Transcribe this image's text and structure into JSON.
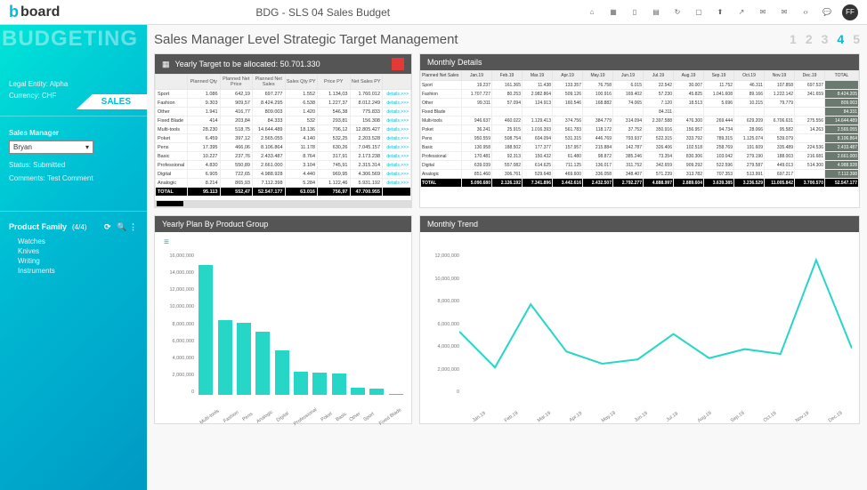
{
  "app": {
    "logo": "board",
    "title": "BDG - SLS 04 Sales Budget",
    "avatar": "FF"
  },
  "sidebar": {
    "watermark": "BUDGETING",
    "sales_tab": "SALES",
    "entity_label": "Legal Entity: Alpha",
    "currency_label": "Currency:  CHF",
    "manager_label": "Sales Manager",
    "manager_value": "Bryan",
    "status_label": "Status:  Submitted",
    "comments_label": "Comments: Test Comment",
    "pf_title": "Product Family",
    "pf_count": "(4/4)",
    "pf_items": [
      "Watches",
      "Knives",
      "Writing",
      "Instruments"
    ]
  },
  "page": {
    "title": "Sales Manager Level Strategic Target Management",
    "steps": [
      "1",
      "2",
      "3",
      "4",
      "5"
    ],
    "active_step": 4
  },
  "allocation": {
    "title": "Yearly Target to be allocated:  50.701.330",
    "headers": [
      "",
      "Planned Qty",
      "Planned Net Price",
      "Planned Net Sales",
      "Sales Qty PY",
      "Price PY",
      "Net Sales PY",
      ""
    ],
    "rows": [
      [
        "Sport",
        "1.086",
        "642,19",
        "697.277",
        "1.552",
        "1.134,03",
        "1.760.012",
        "details >>>"
      ],
      [
        "Fashion",
        "9.303",
        "909,57",
        "8.424.295",
        "6.538",
        "1.227,37",
        "8.012.249",
        "details >>>"
      ],
      [
        "Other",
        "1.941",
        "416,77",
        "809.003",
        "1.420",
        "546,38",
        "775.833",
        "details >>>"
      ],
      [
        "Fixed Blade",
        "414",
        "203,84",
        "84.333",
        "532",
        "293,81",
        "156.308",
        "details >>>"
      ],
      [
        "Multi-tools",
        "28.230",
        "518,75",
        "14.644.489",
        "18.136",
        "706,12",
        "12.805.427",
        "details >>>"
      ],
      [
        "Poket",
        "6.459",
        "397,12",
        "2.565.055",
        "4.140",
        "532,25",
        "2.203.528",
        "details >>>"
      ],
      [
        "Pens",
        "17.395",
        "466,06",
        "8.106.864",
        "11.178",
        "630,26",
        "7.045.157",
        "details >>>"
      ],
      [
        "Basic",
        "10.227",
        "237,76",
        "2.433.487",
        "8.764",
        "317,91",
        "2.173.238",
        "details >>>"
      ],
      [
        "Professional",
        "4.830",
        "550,89",
        "2.661.000",
        "3.104",
        "745,91",
        "2.315.314",
        "details >>>"
      ],
      [
        "Digital",
        "6.905",
        "722,65",
        "4.988.928",
        "4.440",
        "969,95",
        "4.306.569",
        "details >>>"
      ],
      [
        "Analogic",
        "8.214",
        "865,93",
        "7.112.398",
        "5.284",
        "1.122,46",
        "5.931.192",
        "details >>>"
      ]
    ],
    "total": [
      "TOTAL",
      "95.113",
      "552,47",
      "52.547.177",
      "63.016",
      "756,97",
      "47.700.955",
      ""
    ]
  },
  "monthly": {
    "title": "Monthly Details",
    "subheader": "Planned Net Sales",
    "months": [
      "Jan.19",
      "Feb.19",
      "Mar.19",
      "Apr.19",
      "May.19",
      "Jun.19",
      "Jul.19",
      "Aug.19",
      "Sep.19",
      "Oct.19",
      "Nov.19",
      "Dec.19",
      "TOTAL"
    ],
    "rows": [
      [
        "Sport",
        "19.237",
        "161.365",
        "11.438",
        "133.357",
        "76.758",
        "6.015",
        "22.542",
        "30.007",
        "11.752",
        "46.311",
        "107.858",
        "697.537"
      ],
      [
        "Fashion",
        "1.707.727",
        "80.253",
        "2.982.864",
        "509.126",
        "100.916",
        "169.402",
        "57.230",
        "45.825",
        "1.041.608",
        "89.166",
        "1.222.142",
        "341.659",
        "8.424.205"
      ],
      [
        "Other",
        "99.311",
        "57.094",
        "124.913",
        "160.546",
        "168.882",
        "74.065",
        "7.120",
        "18.513",
        "5.696",
        "10.215",
        "79.779",
        "",
        "809.003"
      ],
      [
        "Fixed Blade",
        "",
        "",
        "",
        "",
        "",
        "",
        "84.311",
        "",
        "",
        "",
        "",
        "",
        "84.331"
      ],
      [
        "Multi-tools",
        "946.637",
        "460.022",
        "1.129.413",
        "374.756",
        "384.779",
        "314.094",
        "2.397.588",
        "476.300",
        "269.444",
        "629.209",
        "6.706.631",
        "275.556",
        "14.644.489"
      ],
      [
        "Poket",
        "36.241",
        "25.915",
        "1.016.393",
        "561.783",
        "118.172",
        "37.752",
        "350.916",
        "156.957",
        "94.734",
        "28.066",
        "95.582",
        "14.263",
        "2.565.055"
      ],
      [
        "Pens",
        "950.559",
        "508.754",
        "604.094",
        "531.315",
        "446.769",
        "793.937",
        "522.315",
        "333.792",
        "789.315",
        "1.125.074",
        "539.079",
        "",
        "8.106.864"
      ],
      [
        "Basic",
        "130.958",
        "188.502",
        "177.377",
        "157.957",
        "215.884",
        "142.787",
        "326.406",
        "102.518",
        "258.769",
        "191.609",
        "335.489",
        "224.536",
        "2.433.487"
      ],
      [
        "Professional",
        "170.481",
        "92.313",
        "150.432",
        "61.480",
        "98.872",
        "385.246",
        "73.354",
        "830.306",
        "103.042",
        "279.190",
        "188.003",
        "216.681",
        "2.661.000"
      ],
      [
        "Digital",
        "639.039",
        "557.082",
        "614.625",
        "711.125",
        "136.017",
        "311.752",
        "342.659",
        "909.292",
        "522.596",
        "279.587",
        "449.013",
        "514.300",
        "4.988.928"
      ],
      [
        "Analogic",
        "851.460",
        "306.761",
        "529.648",
        "469.600",
        "336.058",
        "348.407",
        "571.239",
        "313.782",
        "707.353",
        "513.991",
        "697.217",
        "",
        "7.112.398"
      ]
    ],
    "total": [
      "TOTAL",
      "5.090.680",
      "2.126.192",
      "7.341.896",
      "3.442.616",
      "2.432.507",
      "2.792.277",
      "4.888.997",
      "2.889.604",
      "3.639.385",
      "3.236.529",
      "11.005.842",
      "3.700.570",
      "52.547.177"
    ]
  },
  "bar_chart": {
    "title": "Yearly Plan By Product Group"
  },
  "line_chart": {
    "title": "Monthly Trend"
  },
  "chart_data": [
    {
      "type": "bar",
      "title": "Yearly Plan By Product Group",
      "ylabel": "",
      "ylim": [
        0,
        16000000
      ],
      "categories": [
        "Multi-tools",
        "Fashion",
        "Pens",
        "Analogic",
        "Digital",
        "Professional",
        "Poket",
        "Basic",
        "Other",
        "Sport",
        "Fixed Blade"
      ],
      "values": [
        14644489,
        8424295,
        8106864,
        7112398,
        4988928,
        2661000,
        2565055,
        2433487,
        809003,
        697277,
        84333
      ],
      "y_ticks": [
        "16,000,000",
        "14,000,000",
        "12,000,000",
        "10,000,000",
        "8,000,000",
        "6,000,000",
        "4,000,000",
        "2,000,000",
        "0"
      ]
    },
    {
      "type": "line",
      "title": "Monthly Trend",
      "ylabel": "",
      "ylim": [
        0,
        12000000
      ],
      "x": [
        "Jan.19",
        "Feb.19",
        "Mar.19",
        "Apr.19",
        "May.19",
        "Jun.19",
        "Jul.19",
        "Aug.19",
        "Sep.19",
        "Oct.19",
        "Nov.19",
        "Dec.19"
      ],
      "values": [
        5090680,
        2126192,
        7341896,
        3442616,
        2432507,
        2792277,
        4888997,
        2889604,
        3639385,
        3236529,
        11005842,
        3700570
      ],
      "y_ticks": [
        "12,000,000",
        "10,000,000",
        "8,000,000",
        "6,000,000",
        "4,000,000",
        "2,000,000",
        "0"
      ]
    }
  ]
}
